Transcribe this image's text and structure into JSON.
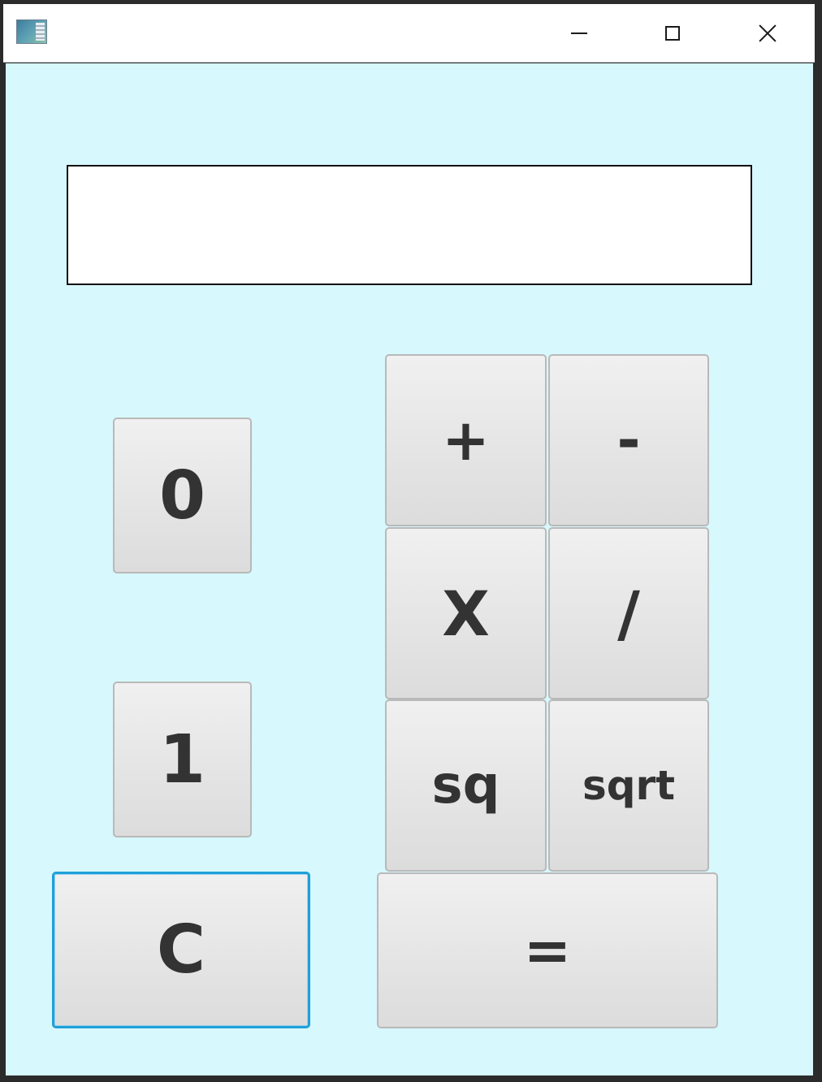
{
  "window": {
    "title": "",
    "controls": {
      "minimize": "minimize-icon",
      "maximize": "maximize-icon",
      "close": "close-icon"
    }
  },
  "display": {
    "value": ""
  },
  "buttons": {
    "zero": "0",
    "one": "1",
    "clear": "C",
    "plus": "+",
    "minus": "-",
    "multiply": "X",
    "divide": "/",
    "square": "sq",
    "sqrt": "sqrt",
    "equals": "="
  },
  "colors": {
    "background": "#d7f8fd",
    "button_text": "#333333",
    "focus_ring": "#1fa0d8"
  }
}
